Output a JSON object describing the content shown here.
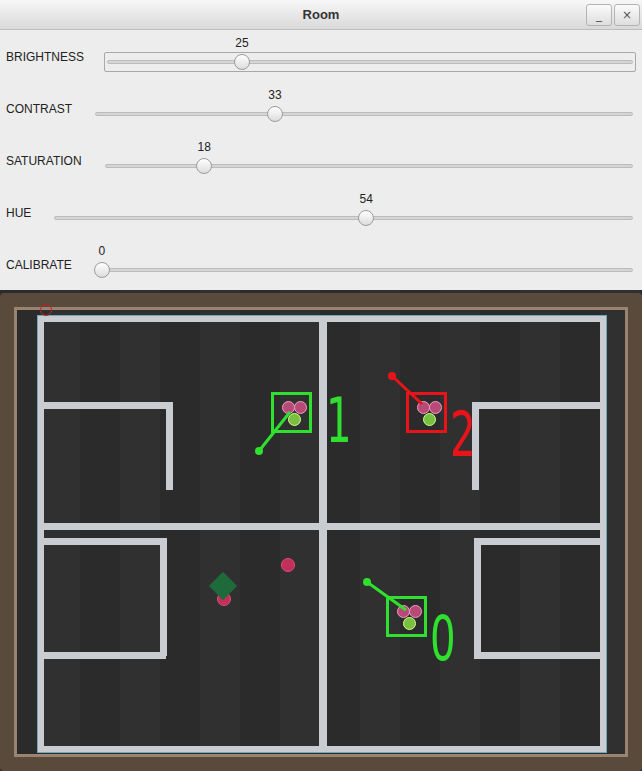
{
  "window": {
    "title": "Room",
    "buttons": [
      "_",
      "×"
    ]
  },
  "sliders": [
    {
      "label": "BRIGHTNESS",
      "value": "25",
      "level": 0.25,
      "focused": true
    },
    {
      "label": "CONTRAST",
      "value": "33",
      "level": 0.33,
      "focused": false
    },
    {
      "label": "SATURATION",
      "value": "18",
      "level": 0.18,
      "focused": false
    },
    {
      "label": "HUE",
      "value": "54",
      "level": 0.54,
      "focused": false
    },
    {
      "label": "CALIBRATE",
      "value": "0",
      "level": 0,
      "focused": false
    }
  ],
  "camera": {
    "robots": [
      {
        "label": "1",
        "color": "#2fe02f"
      },
      {
        "label": "2",
        "color": "#e8141a"
      },
      {
        "label": "0",
        "color": "#2fe02f"
      }
    ]
  }
}
